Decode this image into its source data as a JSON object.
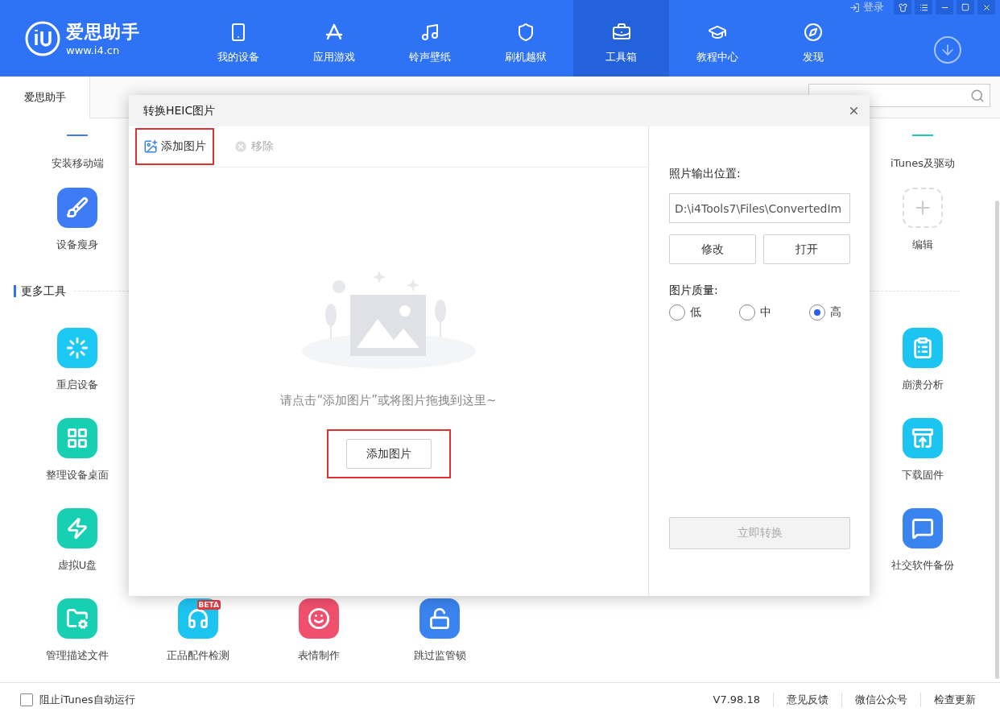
{
  "app": {
    "logo_name": "爱思助手",
    "logo_url": "www.i4.cn",
    "login": "登录"
  },
  "nav": [
    {
      "label": "我的设备",
      "selected": false
    },
    {
      "label": "应用游戏",
      "selected": false
    },
    {
      "label": "铃声壁纸",
      "selected": false
    },
    {
      "label": "刷机越狱",
      "selected": false
    },
    {
      "label": "工具箱",
      "selected": true
    },
    {
      "label": "教程中心",
      "selected": false
    },
    {
      "label": "发现",
      "selected": false
    }
  ],
  "tabs": [
    {
      "label": "爱思助手",
      "selected": true
    }
  ],
  "tool_sections": [
    {
      "rows": [
        {
          "left": [
            {
              "kind": "partial",
              "label": "安装移动端",
              "color": "#3d7cf5"
            }
          ],
          "right": {
            "kind": "partial",
            "label": "iTunes及驱动",
            "color": "#1fc8c0"
          }
        },
        {
          "left": [
            {
              "kind": "tool",
              "label": "设备瘦身",
              "color": "#3d7cf5"
            }
          ],
          "right": {
            "kind": "add",
            "label": "编辑"
          }
        }
      ]
    },
    {
      "heading": "更多工具",
      "rows": [
        {
          "left": [
            {
              "kind": "tool",
              "label": "重启设备",
              "color": "#1cc9f5"
            }
          ],
          "right": {
            "kind": "tool",
            "label": "崩溃分析",
            "color": "#1cc4f2"
          }
        },
        {
          "left": [
            {
              "kind": "tool",
              "label": "整理设备桌面",
              "color": "#17d0b4"
            }
          ],
          "right": {
            "kind": "tool",
            "label": "下载固件",
            "color": "#1cc4f2"
          }
        },
        {
          "left": [
            {
              "kind": "tool",
              "label": "虚拟U盘",
              "color": "#17d0b4"
            }
          ],
          "right": {
            "kind": "tool",
            "label": "社交软件备份",
            "color": "#3a84f0"
          }
        },
        {
          "left": [
            {
              "kind": "tool",
              "label": "管理描述文件",
              "color": "#17d0b4"
            },
            {
              "kind": "tool",
              "label": "正品配件检测",
              "color": "#1cc4f2",
              "badge": "BETA"
            },
            {
              "kind": "tool",
              "label": "表情制作",
              "color": "#f0506e"
            },
            {
              "kind": "tool",
              "label": "跳过监管锁",
              "color": "#3a84f0"
            }
          ]
        }
      ]
    }
  ],
  "dialog": {
    "title": "转换HEIC图片",
    "toolbar": [
      {
        "kind": "add",
        "label": "添加图片",
        "disabled": false,
        "highlighted": true
      },
      {
        "kind": "remove",
        "label": "移除",
        "disabled": true,
        "highlighted": false
      }
    ],
    "hint": "请点击“添加图片”或将图片拖拽到这里~",
    "add_button": {
      "label": "添加图片",
      "highlighted": true
    },
    "output_label": "照片输出位置:",
    "output_path": "D:\\i4Tools7\\Files\\ConvertedIm",
    "path_buttons": [
      "修改",
      "打开"
    ],
    "quality_label": "图片质量:",
    "quality": [
      {
        "label": "低",
        "selected": false
      },
      {
        "label": "中",
        "selected": false
      },
      {
        "label": "高",
        "selected": true
      }
    ],
    "convert": {
      "label": "立即转换",
      "disabled": true
    }
  },
  "status_bar": {
    "checkbox": {
      "label": "阻止iTunes自动运行",
      "checked": false
    },
    "links": [
      "V7.98.18",
      "意见反馈",
      "微信公众号",
      "检查更新"
    ]
  }
}
